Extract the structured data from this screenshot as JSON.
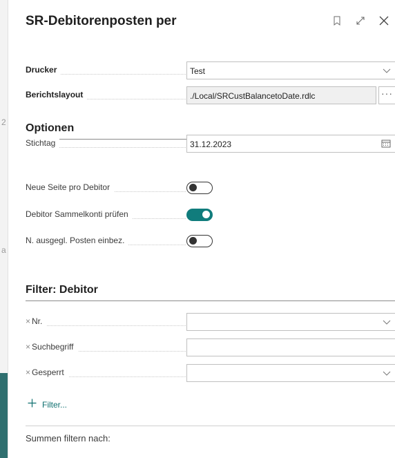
{
  "dialog": {
    "title": "SR-Debitorenposten per"
  },
  "fields": {
    "drucker": {
      "label": "Drucker",
      "value": "Test"
    },
    "berichtslayout": {
      "label": "Berichtslayout",
      "value": "./Local/SRCustBalancetoDate.rdlc",
      "more_label": "···"
    }
  },
  "optionen": {
    "title": "Optionen",
    "stichtag": {
      "label": "Stichtag",
      "value": "31.12.2023"
    },
    "neue_seite": {
      "label": "Neue Seite pro Debitor",
      "checked": false
    },
    "sammelkonti": {
      "label": "Debitor Sammelkonti prüfen",
      "checked": true
    },
    "ausgegl": {
      "label": "N. ausgegl. Posten einbez.",
      "checked": false
    }
  },
  "filter": {
    "title": "Filter: Debitor",
    "rows": [
      {
        "label": "Nr.",
        "value": ""
      },
      {
        "label": "Suchbegriff",
        "value": ""
      },
      {
        "label": "Gesperrt",
        "value": ""
      }
    ],
    "add_label": "Filter...",
    "summen_label": "Summen filtern nach:"
  },
  "colors": {
    "accent": "#107c7c",
    "link": "#0e6f6f"
  },
  "icons": [
    "bookmark-icon",
    "expand-icon",
    "close-icon",
    "chevron-down-icon",
    "calendar-icon",
    "plus-icon",
    "remove-filter-icon"
  ]
}
